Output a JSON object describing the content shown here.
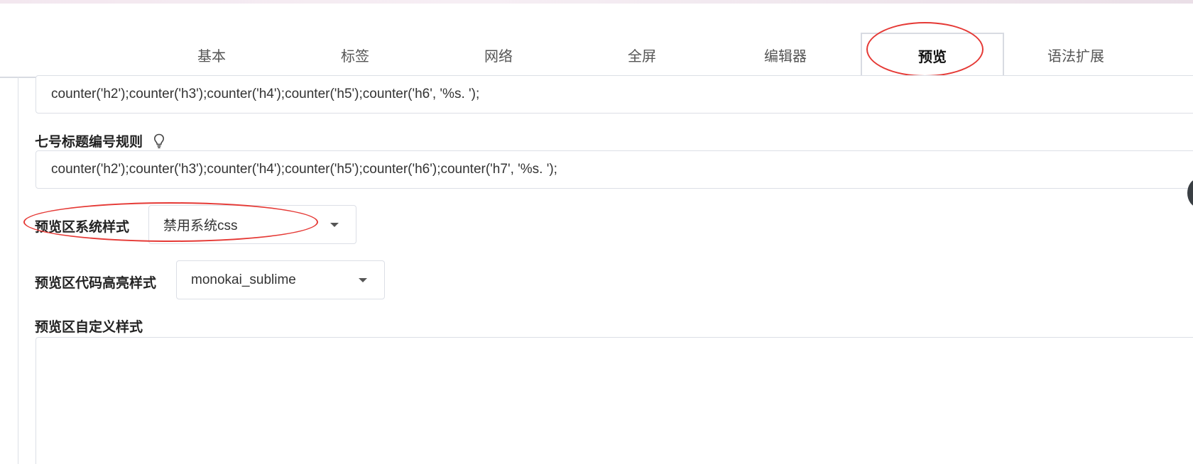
{
  "tabs": [
    {
      "label": "基本"
    },
    {
      "label": "标签"
    },
    {
      "label": "网络"
    },
    {
      "label": "全屏"
    },
    {
      "label": "编辑器"
    },
    {
      "label": "预览"
    },
    {
      "label": "语法扩展"
    }
  ],
  "active_tab": "预览",
  "h6_rule": {
    "value": "counter('h2');counter('h3');counter('h4');counter('h5');counter('h6', '%s. ');"
  },
  "h7_rule": {
    "label": "七号标题编号规则",
    "icon": "lightbulb-icon",
    "value": "counter('h2');counter('h3');counter('h4');counter('h5');counter('h6');counter('h7', '%s. ');"
  },
  "system_style": {
    "label": "预览区系统样式",
    "selected": "禁用系统css"
  },
  "code_highlight": {
    "label": "预览区代码高亮样式",
    "selected": "monokai_sublime"
  },
  "custom_style": {
    "label": "预览区自定义样式",
    "value": ""
  },
  "colors": {
    "annotation": "#e53935",
    "border": "#dcdfe6"
  }
}
